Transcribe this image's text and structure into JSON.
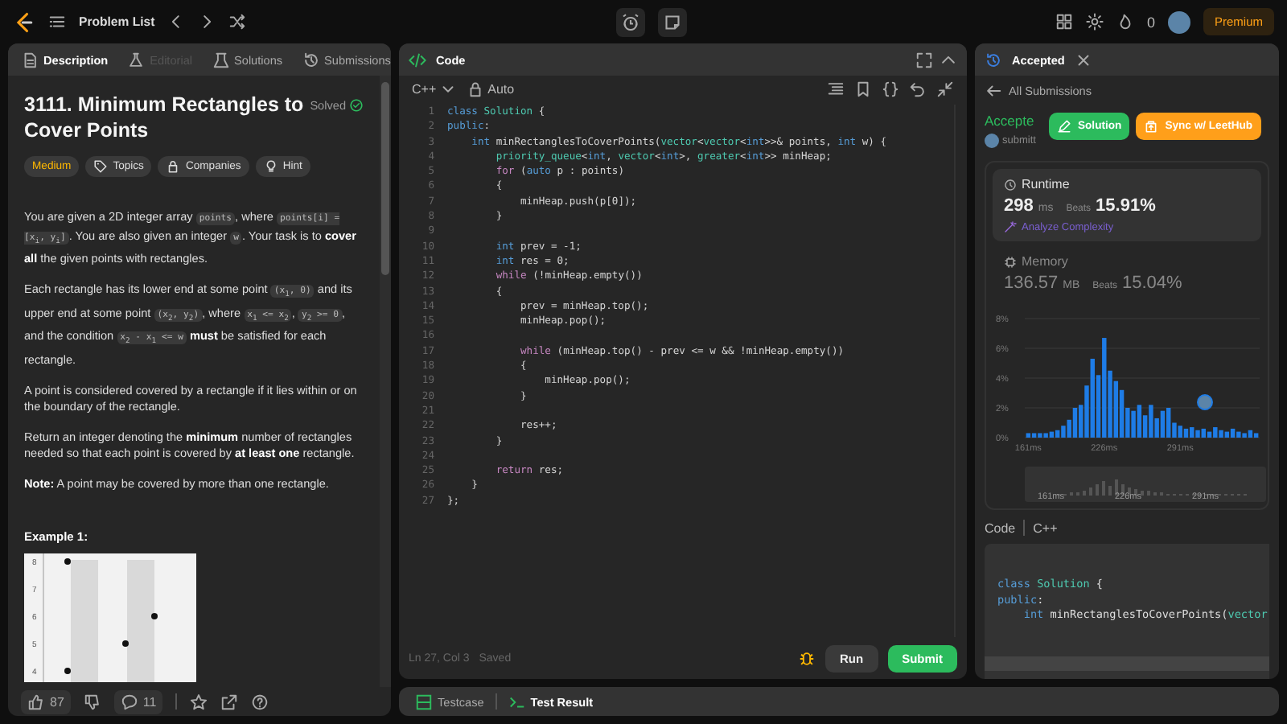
{
  "top_bar": {
    "problem_list": "Problem List",
    "streak_count": "0",
    "premium": "Premium"
  },
  "description_panel": {
    "tabs": [
      {
        "label": "Description",
        "selected": true,
        "disabled": false
      },
      {
        "label": "Editorial",
        "selected": false,
        "disabled": true
      },
      {
        "label": "Solutions",
        "selected": false,
        "disabled": false
      },
      {
        "label": "Submissions",
        "selected": false,
        "disabled": false
      }
    ],
    "title": "3111. Minimum Rectangles to Cover Points",
    "status": "Solved",
    "difficulty": "Medium",
    "tags": [
      {
        "label": "Topics",
        "kind": "tag"
      },
      {
        "label": "Companies",
        "kind": "lock"
      },
      {
        "label": "Hint",
        "kind": "bulb"
      }
    ],
    "paragraphs": [
      [
        {
          "kind": "text",
          "text": "You are given a 2D integer array "
        },
        {
          "kind": "code",
          "text": "points"
        },
        {
          "kind": "text",
          "text": ", where "
        },
        {
          "kind": "code",
          "text": "points[i] = [x$_{i}$, y$_{i}$]"
        },
        {
          "kind": "text",
          "text": ". You are also given an integer "
        },
        {
          "kind": "code",
          "text": "w"
        },
        {
          "kind": "text",
          "text": ". Your task is to "
        },
        {
          "kind": "bold",
          "text": "cover all"
        },
        {
          "kind": "text",
          "text": " the given points with rectangles."
        }
      ],
      [
        {
          "kind": "text",
          "text": "Each rectangle has its lower end at some point "
        },
        {
          "kind": "code",
          "text": "(x$_{1}$, 0)"
        },
        {
          "kind": "text",
          "text": " and its upper end at some point "
        },
        {
          "kind": "code",
          "text": "(x$_{2}$, y$_{2}$)"
        },
        {
          "kind": "text",
          "text": ", where "
        },
        {
          "kind": "code",
          "text": "x$_{1}$ <= x$_{2}$"
        },
        {
          "kind": "text",
          "text": ", "
        },
        {
          "kind": "code",
          "text": "y$_{2}$ >= 0"
        },
        {
          "kind": "text",
          "text": ", and the condition "
        },
        {
          "kind": "code",
          "text": "x$_{2}$ - x$_{1}$ <= w"
        },
        {
          "kind": "bold",
          "text": " must"
        },
        {
          "kind": "text",
          "text": " be satisfied for each rectangle."
        }
      ],
      [
        {
          "kind": "text",
          "text": "A point is considered covered by a rectangle if it lies within or on the boundary of the rectangle."
        }
      ],
      [
        {
          "kind": "text",
          "text": "Return an integer denoting the "
        },
        {
          "kind": "bold",
          "text": "minimum"
        },
        {
          "kind": "text",
          "text": " number of rectangles needed so that each point is covered by "
        },
        {
          "kind": "bold",
          "text": "at least one"
        },
        {
          "kind": "text",
          "text": " rectangle."
        }
      ],
      [
        {
          "kind": "bold",
          "text": "Note:"
        },
        {
          "kind": "text",
          "text": " A point may be covered by more than one rectangle."
        }
      ]
    ],
    "example_heading": "Example 1:",
    "example_figure": {
      "y_labels": [
        "8",
        "7",
        "6",
        "5",
        "4"
      ]
    },
    "footer": {
      "likes": "87",
      "comments": "11"
    }
  },
  "code_panel": {
    "title": "Code",
    "language": "C++",
    "mode": "Auto",
    "lines": [
      {
        "n": "1",
        "code": "class Solution {"
      },
      {
        "n": "2",
        "code": "public:"
      },
      {
        "n": "3",
        "code": "    int minRectanglesToCoverPoints(vector<vector<int>>& points, int w) {"
      },
      {
        "n": "4",
        "code": "        priority_queue<int, vector<int>, greater<int>> minHeap;"
      },
      {
        "n": "5",
        "code": "        for (auto p : points)"
      },
      {
        "n": "6",
        "code": "        {"
      },
      {
        "n": "7",
        "code": "            minHeap.push(p[0]);"
      },
      {
        "n": "8",
        "code": "        }"
      },
      {
        "n": "9"
      },
      {
        "n": "10",
        "code": "        int prev = -1;"
      },
      {
        "n": "11",
        "code": "        int res = 0;"
      },
      {
        "n": "12",
        "code": "        while (!minHeap.empty())"
      },
      {
        "n": "13",
        "code": "        {"
      },
      {
        "n": "14",
        "code": "            prev = minHeap.top();"
      },
      {
        "n": "15",
        "code": "            minHeap.pop();"
      },
      {
        "n": "16"
      },
      {
        "n": "17",
        "code": "            while (minHeap.top() - prev <= w && !minHeap.empty())"
      },
      {
        "n": "18",
        "code": "            {"
      },
      {
        "n": "19",
        "code": "                minHeap.pop();"
      },
      {
        "n": "20",
        "code": "            }"
      },
      {
        "n": "21"
      },
      {
        "n": "22",
        "code": "            res++;"
      },
      {
        "n": "23",
        "code": "        }"
      },
      {
        "n": "24"
      },
      {
        "n": "25",
        "code": "        return res;"
      },
      {
        "n": "26",
        "code": "    }"
      },
      {
        "n": "27",
        "code": "};"
      }
    ],
    "cursor": "Ln 27, Col 3",
    "save_status": "Saved",
    "run": "Run",
    "submit": "Submit"
  },
  "result_panel": {
    "tab": "Accepted",
    "back": "All Submissions",
    "status": "Accepte",
    "submitter": "submitt",
    "solution_button": "Solution",
    "sync_button": "Sync w/ LeetHub",
    "runtime": {
      "label": "Runtime",
      "value": "298",
      "unit": "ms",
      "beats_label": "Beats",
      "beats": "15.91%",
      "analyze": "Analyze Complexity"
    },
    "memory": {
      "label": "Memory",
      "value": "136.57",
      "unit": "MB",
      "beats_label": "Beats",
      "beats": "15.04%"
    },
    "chart_data": {
      "type": "bar",
      "ylim": [
        0,
        8
      ],
      "xlim": [
        158,
        359
      ],
      "grid": true,
      "yticks": [
        {
          "value": 0,
          "label": "0%"
        },
        {
          "value": 2,
          "label": "2%"
        },
        {
          "value": 4,
          "label": "4%"
        },
        {
          "value": 6,
          "label": "6%"
        },
        {
          "value": 8,
          "label": "8%"
        }
      ],
      "xticks": [
        {
          "value": 161,
          "label": "161ms"
        },
        {
          "value": 226,
          "label": "226ms"
        },
        {
          "value": 291,
          "label": "291ms"
        }
      ],
      "x": [
        161,
        166,
        171,
        176,
        181,
        186,
        191,
        196,
        201,
        206,
        211,
        216,
        221,
        226,
        231,
        236,
        241,
        246,
        251,
        256,
        261,
        266,
        271,
        276,
        281,
        286,
        291,
        296,
        301,
        306,
        311,
        316,
        321,
        326,
        331,
        336,
        341,
        346,
        351,
        356
      ],
      "series": [
        {
          "color": "#1e7ce6",
          "values": [
            0.3,
            0.3,
            0.3,
            0.3,
            0.4,
            0.5,
            0.8,
            1.2,
            2.0,
            2.2,
            3.5,
            5.3,
            4.2,
            6.7,
            4.5,
            3.8,
            3.2,
            2.0,
            1.8,
            2.2,
            1.5,
            2.2,
            1.3,
            1.8,
            2.0,
            1.0,
            0.8,
            0.6,
            0.7,
            0.5,
            0.6,
            0.4,
            0.7,
            0.5,
            0.4,
            0.6,
            0.4,
            0.3,
            0.5,
            0.3
          ]
        }
      ]
    },
    "overview_labels": [
      "161ms",
      "226ms",
      "291ms"
    ],
    "code_label": "Code",
    "code_language": "C++",
    "code_lines": [
      "class Solution {",
      "public:",
      "    int minRectanglesToCoverPoints(vector"
    ]
  },
  "console": {
    "tabs": [
      {
        "label": "Testcase",
        "selected": false
      },
      {
        "label": "Test Result",
        "selected": true
      }
    ]
  }
}
